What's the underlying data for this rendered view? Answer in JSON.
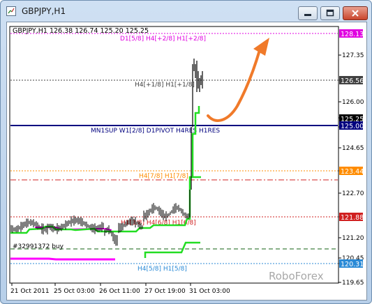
{
  "window": {
    "title": "GBPJPY,H1"
  },
  "chart": {
    "header": "GBPJPY,H1  126.38 126.74 125.20 125.25",
    "watermark": "RoboForex",
    "order_label": "#32991372 buy",
    "y_ticks": [
      "127.35",
      "126.56",
      "126.00",
      "125.25",
      "125.00",
      "124.65",
      "123.44",
      "122.70",
      "121.88",
      "121.20",
      "120.45",
      "120.31",
      "119.65"
    ],
    "x_ticks": [
      "21 Oct 2011",
      "25 Oct 03:00",
      "26 Oct 11:00",
      "27 Oct 19:00",
      "31 Oct 03:00"
    ],
    "lines": [
      {
        "label": "D1[5/8] H4[+2/8] H1[+2/8]",
        "price": "128.13",
        "color": "#e000e0"
      },
      {
        "label": "H4[+1/8] H1[+1/8]",
        "price": "126.56",
        "color": "#404040"
      },
      {
        "label": "MN1SUP W1[2/8] D1PIVOT H4RES H1RES",
        "price": "125.00",
        "color": "#00007f"
      },
      {
        "label": "H4[7/8] H1[7/8]",
        "price": "123.44",
        "color": "#ff8c00"
      },
      {
        "label": "H1[3/8] H4[6/8] H1[6/8]",
        "price": "121.88",
        "color": "#d02020"
      },
      {
        "label": "H4[5/8] H1[5/8]",
        "price": "120.31",
        "color": "#2a8ad6"
      }
    ],
    "current_price": "125.25",
    "colors": {
      "price_bars": "#000000",
      "green_level": "#22dd22",
      "magenta_level": "#ff00ff",
      "arrow": "#f07a2a",
      "navy_line": "#00007f"
    }
  }
}
